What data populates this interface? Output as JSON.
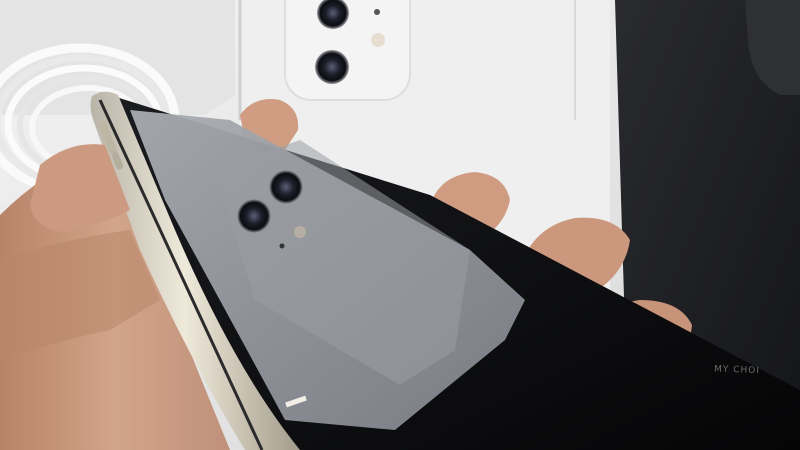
{
  "scene": {
    "colors": {
      "background_white": "#ebebeb",
      "dark_box": "#1e1f22",
      "skin": "#c99a7f",
      "skin_shadow": "#9f6f56",
      "phone_frame": "#d9d3c4",
      "phone_screen": "#0b0b0d",
      "reflection": "#8d9096"
    },
    "icons": [
      "camera-lens-icon",
      "coiled-cable",
      "hand"
    ]
  },
  "box_text": "MY CHOI"
}
